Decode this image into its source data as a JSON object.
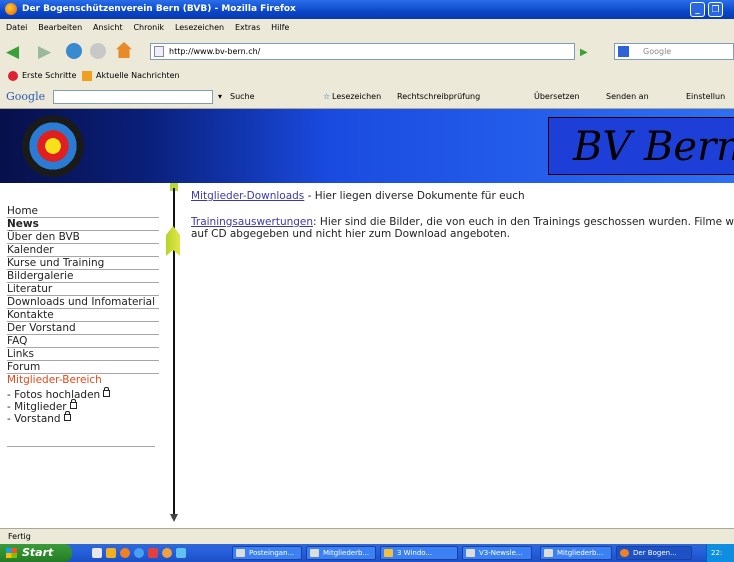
{
  "window": {
    "title": "Der Bogenschützenverein Bern (BVB) - Mozilla Firefox",
    "minimize_glyph": "_",
    "maximize_glyph": "❐"
  },
  "menu": [
    "Datei",
    "Bearbeiten",
    "Ansicht",
    "Chronik",
    "Lesezeichen",
    "Extras",
    "Hilfe"
  ],
  "nav": {
    "url": "http://www.bv-bern.ch/",
    "search_placeholder": "Google"
  },
  "bookmarks": [
    "Erste Schritte",
    "Aktuelle Nachrichten"
  ],
  "google_toolbar": {
    "label": "Google",
    "items": [
      "Suche",
      "Lesezeichen",
      "Rechtschreibprüfung",
      "Übersetzen",
      "Senden an",
      "Einstellun"
    ]
  },
  "site": {
    "title": "BV Bern"
  },
  "sidebar": {
    "items": [
      {
        "label": "Home",
        "style": "normal"
      },
      {
        "label": "News",
        "style": "bold"
      },
      {
        "label": "Über den BVB",
        "style": "normal"
      },
      {
        "label": "Kalender",
        "style": "normal"
      },
      {
        "label": "Kurse und Training",
        "style": "normal"
      },
      {
        "label": "Bildergalerie",
        "style": "normal"
      },
      {
        "label": "Literatur",
        "style": "normal"
      },
      {
        "label": "Downloads und Infomaterial",
        "style": "normal"
      },
      {
        "label": "Kontakte",
        "style": "normal"
      },
      {
        "label": "Der Vorstand",
        "style": "normal"
      },
      {
        "label": "FAQ",
        "style": "normal"
      },
      {
        "label": "Links",
        "style": "normal"
      },
      {
        "label": "Forum",
        "style": "normal"
      }
    ],
    "members_label": "Mitglieder-Bereich",
    "sub_items": [
      "- Fotos hochladen",
      "- Mitglieder",
      "- Vorstand"
    ],
    "accent_color": "#e04a18"
  },
  "content": {
    "para1": {
      "link": "Mitglieder-Downloads",
      "text": " - Hier liegen diverse Dokumente für euch"
    },
    "para2": {
      "link": "Trainingsauswertungen",
      "text": ": Hier sind die Bilder, die von euch in den Trainings geschossen wurden. Filme werd",
      "text2": "auf CD abgegeben und nicht hier zum Download angeboten."
    }
  },
  "status": {
    "text": "Fertig"
  },
  "taskbar": {
    "start": "Start",
    "tasks": [
      {
        "label": "Posteingan...",
        "active": false
      },
      {
        "label": "Mitgliederb...",
        "active": false
      },
      {
        "label": "3 Windo...",
        "active": false
      },
      {
        "label": "V3-Newsle...",
        "active": false
      },
      {
        "label": "Mitgliederb...",
        "active": false
      },
      {
        "label": "Der Bogen...",
        "active": true
      }
    ],
    "clock": "22:"
  }
}
